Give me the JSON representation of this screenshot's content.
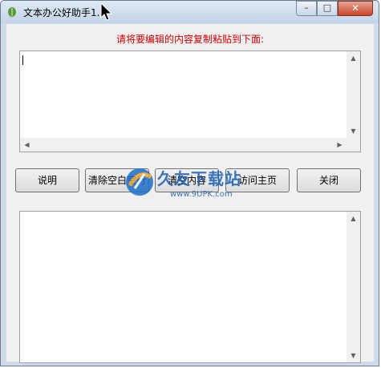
{
  "window": {
    "title": "文本办公好助手1."
  },
  "controls": {
    "minimize": "–",
    "maximize": "□",
    "close": "✕"
  },
  "main": {
    "prompt": "请将要编辑的内容复制粘贴到下面:",
    "input_text": "",
    "output_text": ""
  },
  "buttons": {
    "help": "说明",
    "clear_blank": "清除空白空行",
    "clear_content": "清空内容",
    "visit_home": "访问主页",
    "close": "关闭"
  },
  "watermark": {
    "text": "久友下载站",
    "url": "www.9UPK.com"
  }
}
